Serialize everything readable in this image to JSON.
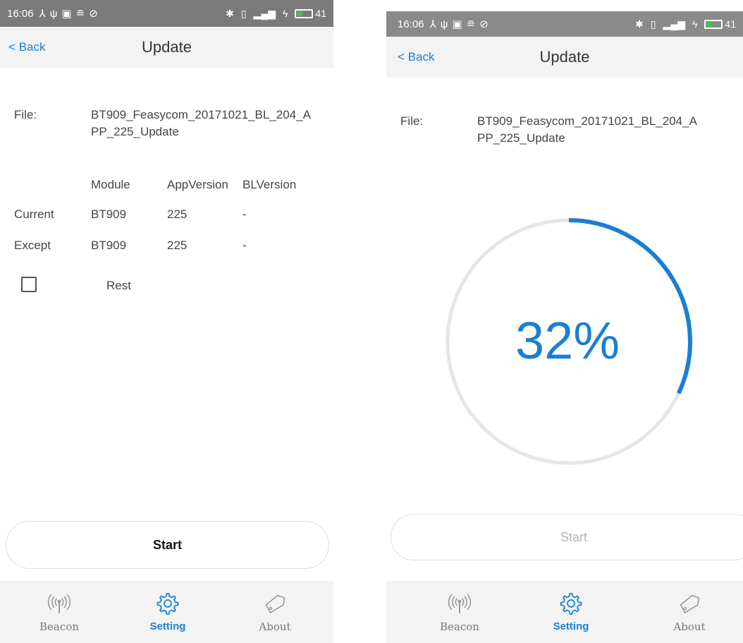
{
  "status": {
    "time": "16:06",
    "battery": "41",
    "battery_level": 0.41,
    "battery_color": "#3fc43f",
    "icons_left": [
      "usb-tether-icon",
      "usb-icon",
      "screenshot-icon",
      "android-debug-icon",
      "check-icon"
    ],
    "icons_right": [
      "bluetooth-icon",
      "vibrate-icon",
      "signal-4g-icon",
      "charging-icon"
    ]
  },
  "colors": {
    "accent": "#1a7fd4",
    "progress_track": "#e6e6e6",
    "nav_bg": "#f3f3f3"
  },
  "left": {
    "back": "< Back",
    "title": "Update",
    "file_label": "File:",
    "file_name_line1": "BT909_Feasycom_20171021_BL_204_A",
    "file_name_line2": "PP_225_Update",
    "table": {
      "headers": [
        "Module",
        "AppVersion",
        "BLVersion"
      ],
      "rows": [
        {
          "label": "Current",
          "module": "BT909",
          "app": "225",
          "bl": "-"
        },
        {
          "label": "Except",
          "module": "BT909",
          "app": "225",
          "bl": "-"
        }
      ]
    },
    "reset_label": "Rest",
    "reset_checked": false,
    "start": "Start"
  },
  "right": {
    "back": "< Back",
    "title": "Update",
    "file_label": "File:",
    "file_name_line1": "BT909_Feasycom_20171021_BL_204_A",
    "file_name_line2": "PP_225_Update",
    "progress_text": "32%",
    "progress_value": 0.32,
    "start": "Start"
  },
  "tabs": [
    {
      "label": "Beacon",
      "icon": "beacon-icon",
      "active": false
    },
    {
      "label": "Setting",
      "icon": "gear-icon",
      "active": true
    },
    {
      "label": "About",
      "icon": "tag-icon",
      "active": false
    }
  ]
}
